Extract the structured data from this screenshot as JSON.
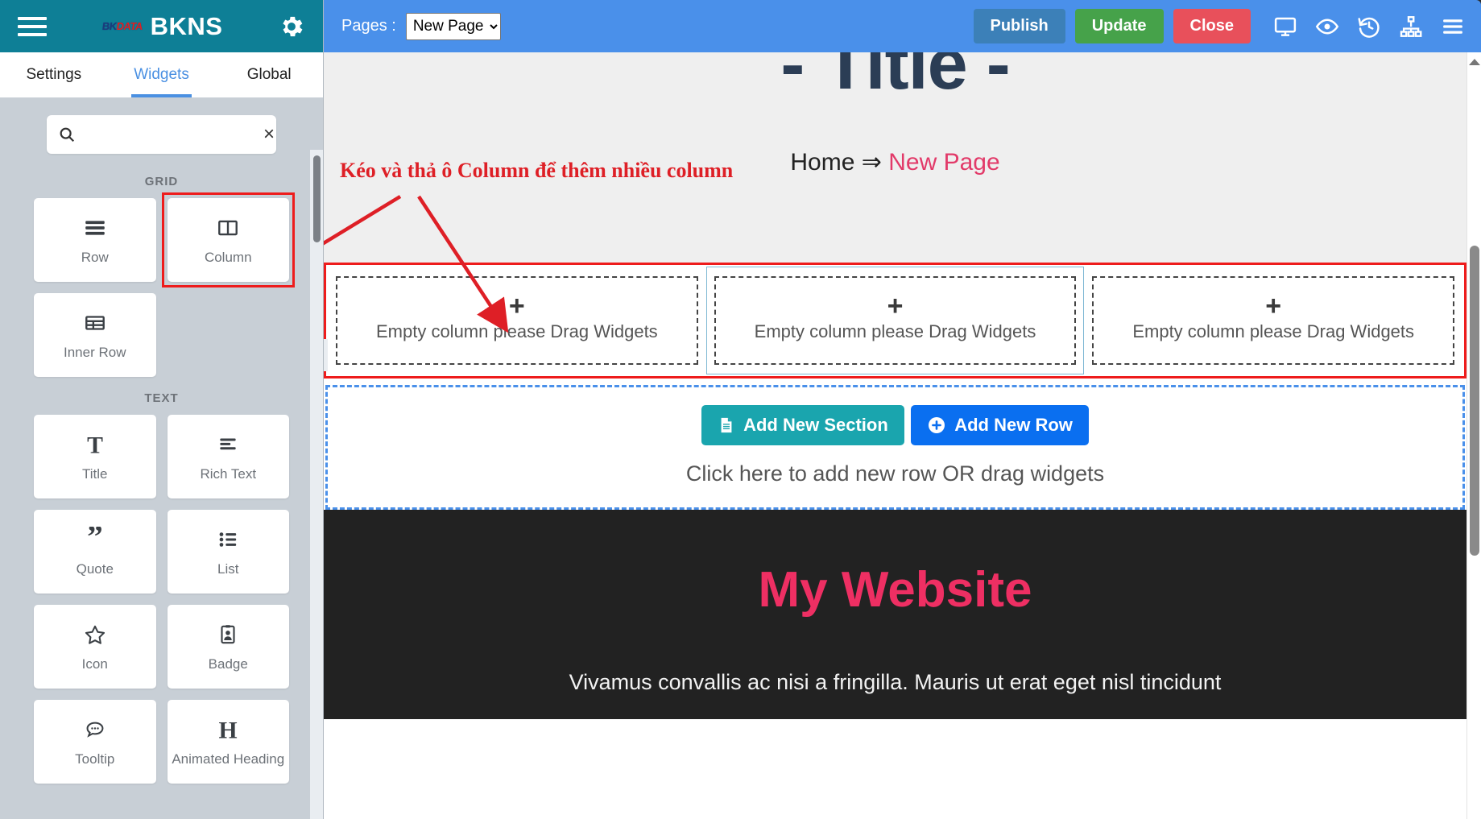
{
  "panel": {
    "brand": {
      "logo_bk": "BK",
      "logo_data": "DATA",
      "title": "BKNS"
    },
    "menu_icon": "hamburger-icon",
    "settings_icon": "gear-icon",
    "tabs": [
      {
        "label": "Settings",
        "active": false
      },
      {
        "label": "Widgets",
        "active": true
      },
      {
        "label": "Global",
        "active": false
      }
    ],
    "search": {
      "value": "",
      "placeholder": "",
      "clear": "×"
    },
    "groups": [
      {
        "label": "GRID",
        "widgets": [
          {
            "label": "Row",
            "icon": "rows-icon",
            "highlighted": false
          },
          {
            "label": "Column",
            "icon": "columns-icon",
            "highlighted": true
          },
          {
            "label": "Inner Row",
            "icon": "table-icon",
            "highlighted": false
          }
        ]
      },
      {
        "label": "TEXT",
        "widgets": [
          {
            "label": "Title",
            "icon": "text-t-icon",
            "highlighted": false
          },
          {
            "label": "Rich Text",
            "icon": "align-left-icon",
            "highlighted": false
          },
          {
            "label": "Quote",
            "icon": "quote-icon",
            "highlighted": false
          },
          {
            "label": "List",
            "icon": "list-icon",
            "highlighted": false
          },
          {
            "label": "Icon",
            "icon": "star-icon",
            "highlighted": false
          },
          {
            "label": "Badge",
            "icon": "id-badge-icon",
            "highlighted": false
          },
          {
            "label": "Tooltip",
            "icon": "speech-bubble-icon",
            "highlighted": false
          },
          {
            "label": "Animated Heading",
            "icon": "heading-h-icon",
            "highlighted": false
          }
        ]
      }
    ]
  },
  "topbar": {
    "pages_label": "Pages :",
    "page_selected": "New Page",
    "page_options": [
      "New Page"
    ],
    "publish": "Publish",
    "update": "Update",
    "close": "Close",
    "icons": [
      {
        "name": "desktop-icon"
      },
      {
        "name": "eye-preview-icon"
      },
      {
        "name": "history-revision-icon"
      },
      {
        "name": "sitemap-icon"
      },
      {
        "name": "menu-icon"
      }
    ],
    "colors": {
      "publish": "#3c80b8",
      "update": "#46a24a",
      "close": "#e8505b",
      "bar": "#4a90ea"
    }
  },
  "annotation": {
    "text": "Kéo và thả ô Column để thêm nhiều column",
    "color": "#de1f26"
  },
  "canvas": {
    "hero_title": "- Title -",
    "breadcrumb": {
      "home": "Home",
      "separator": "⇒",
      "current": "New Page"
    },
    "columns": [
      {
        "plus": "+",
        "text": "Empty column please Drag Widgets",
        "selected": false
      },
      {
        "plus": "+",
        "text": "Empty column please Drag Widgets",
        "selected": true
      },
      {
        "plus": "+",
        "text": "Empty column please Drag Widgets",
        "selected": false
      }
    ],
    "collapse_handle": "‹",
    "addzone": {
      "add_section": "Add New Section",
      "add_row": "Add New Row",
      "hint": "Click here to add new row OR drag widgets"
    },
    "dark_section": {
      "title": "My Website",
      "subtitle": "Vivamus convallis ac nisi a fringilla. Mauris ut erat eget nisl tincidunt"
    }
  }
}
